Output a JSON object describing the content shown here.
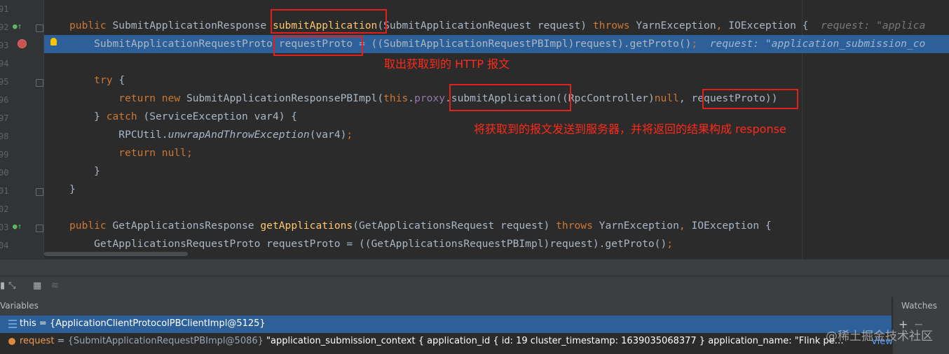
{
  "editor": {
    "line_numbers": [
      "91",
      "92",
      "93",
      "94",
      "95",
      "96",
      "97",
      "98",
      "99",
      "00",
      "01",
      "02",
      "03",
      "04"
    ],
    "lines": [
      {
        "segments": []
      },
      {
        "segments": [
          {
            "t": "public ",
            "c": "k"
          },
          {
            "t": "SubmitApplicationResponse "
          },
          {
            "t": "submitApplication",
            "c": "fn"
          },
          {
            "t": "(SubmitApplicationRequest request) "
          },
          {
            "t": "throws ",
            "c": "k"
          },
          {
            "t": "YarnException"
          },
          {
            "t": ", ",
            "c": "k"
          },
          {
            "t": "IOException {  "
          },
          {
            "t": "request: \"applica",
            "c": "hint"
          }
        ]
      },
      {
        "segments": [
          {
            "t": "    SubmitApplicationRequestProto requestProto = ((SubmitApplicationRequestPBImpl)request).getProto()"
          },
          {
            "t": ";",
            "c": "k"
          },
          {
            "t": "  request: \"application_submission_co",
            "c": "hint"
          }
        ]
      },
      {
        "segments": []
      },
      {
        "segments": [
          {
            "t": "    "
          },
          {
            "t": "try ",
            "c": "k"
          },
          {
            "t": "{"
          }
        ]
      },
      {
        "segments": [
          {
            "t": "        "
          },
          {
            "t": "return new ",
            "c": "k"
          },
          {
            "t": "SubmitApplicationResponsePBImpl("
          },
          {
            "t": "this",
            "c": "k"
          },
          {
            "t": "."
          },
          {
            "t": "proxy",
            "c": "pf"
          },
          {
            "t": ".submitApplication((RpcController)"
          },
          {
            "t": "null",
            "c": "k"
          },
          {
            "t": ", requestProto))"
          }
        ]
      },
      {
        "segments": [
          {
            "t": "    } "
          },
          {
            "t": "catch ",
            "c": "k"
          },
          {
            "t": "(ServiceException var4) {"
          }
        ]
      },
      {
        "segments": [
          {
            "t": "        RPCUtil."
          },
          {
            "t": "unwrapAndThrowException",
            "c": "it"
          },
          {
            "t": "(var4)"
          },
          {
            "t": ";",
            "c": "k"
          }
        ]
      },
      {
        "segments": [
          {
            "t": "        "
          },
          {
            "t": "return null;",
            "c": "k"
          }
        ]
      },
      {
        "segments": [
          {
            "t": "    }"
          }
        ]
      },
      {
        "segments": [
          {
            "t": "}"
          }
        ]
      },
      {
        "segments": []
      },
      {
        "segments": [
          {
            "t": "public ",
            "c": "k"
          },
          {
            "t": "GetApplicationsResponse "
          },
          {
            "t": "getApplications",
            "c": "fn"
          },
          {
            "t": "(GetApplicationsRequest request) "
          },
          {
            "t": "throws ",
            "c": "k"
          },
          {
            "t": "YarnException"
          },
          {
            "t": ", ",
            "c": "k"
          },
          {
            "t": "IOException {"
          }
        ]
      },
      {
        "segments": [
          {
            "t": "    GetApplicationsRequestProto requestProto = ((GetApplicationsRequestPBImpl)request).getProto()"
          },
          {
            "t": ";",
            "c": "k"
          }
        ]
      }
    ]
  },
  "annotations": {
    "note1": "取出获取到的 HTTP 报文",
    "note2": "将获取到的报文发送到服务器，并将返回的结果构成 response"
  },
  "debugger": {
    "variables_title": "Variables",
    "watches_title": "Watches",
    "watches_add": "+",
    "watches_remove": "−",
    "var_this": "this = {ApplicationClientProtocolPBClientImpl@5125}",
    "var_request_name": "request",
    "var_request_eq": " = ",
    "var_request_type": "{SubmitApplicationRequestPBImpl@5086}",
    "var_request_value": " \"application_submission_context { application_id { id: 19 cluster_timestamp: 1639035068377 } application_name: \"Flink pe…",
    "view_link": "View"
  },
  "watermark": "@稀土掘金技术社区",
  "colors": {
    "keyword": "#cc7832",
    "method": "#ffc66d",
    "field": "#9876aa",
    "selection": "#2d6099",
    "annotation": "#ff2a1a"
  }
}
